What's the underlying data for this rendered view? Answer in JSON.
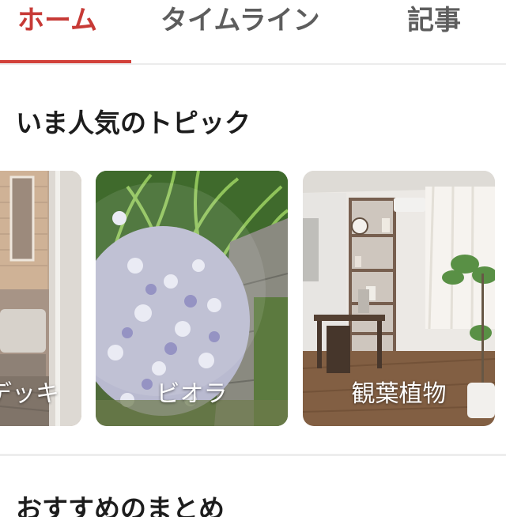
{
  "tabs": [
    {
      "label": "ホーム",
      "active": true
    },
    {
      "label": "タイムライン",
      "active": false
    },
    {
      "label": "記事",
      "active": false
    }
  ],
  "colors": {
    "accent": "#d2413a",
    "tab_inactive": "#5d5d5d",
    "text": "#1d1d1d"
  },
  "topics": {
    "title": "いま人気のトピック",
    "cards": [
      {
        "label": "デッキ",
        "visible_text": "デッキ"
      },
      {
        "label": "ビオラ"
      },
      {
        "label": "観葉植物"
      }
    ]
  },
  "next_section": {
    "title": "おすすめのまとめ"
  }
}
